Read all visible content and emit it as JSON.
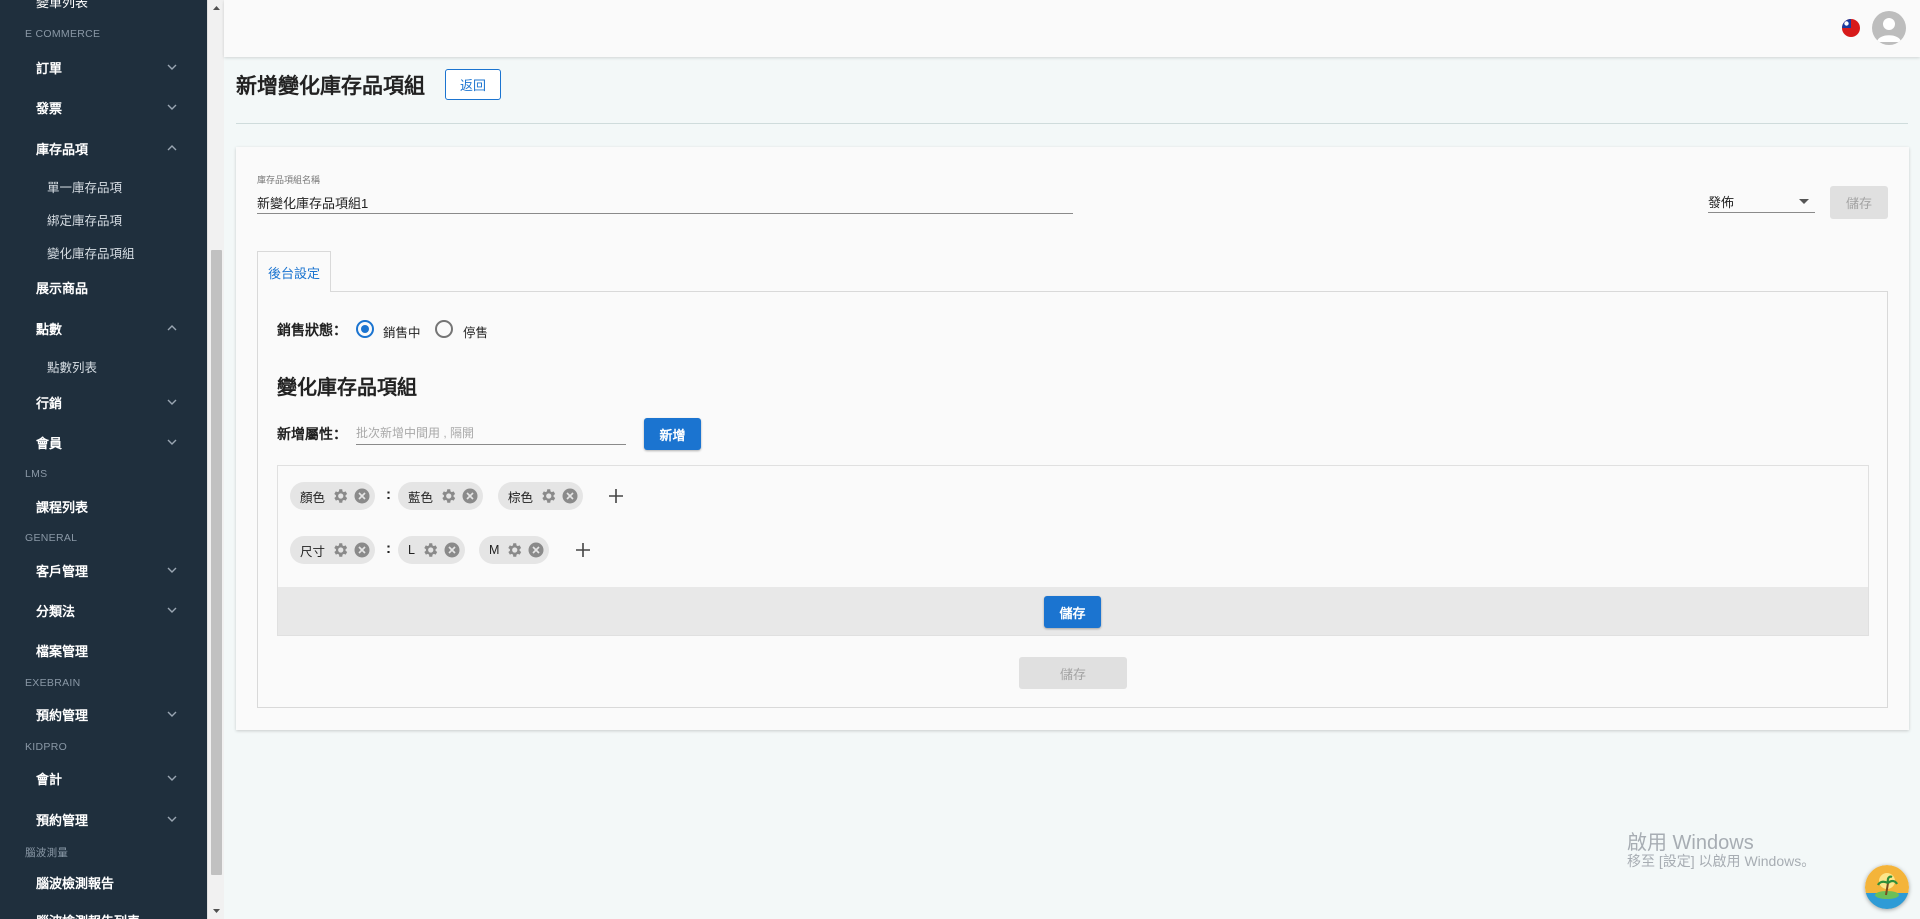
{
  "sidebar": {
    "sections": {
      "ecommerce": "E COMMERCE",
      "lms": "LMS",
      "general": "GENERAL",
      "exebrain": "EXEBRAIN",
      "kidpro": "KIDPRO",
      "eeg": "腦波測量"
    },
    "items": {
      "top_partial": "變單列表",
      "orders": "訂單",
      "invoices": "發票",
      "inventory": "庫存品項",
      "inventory_single": "單一庫存品項",
      "inventory_bundle": "綁定庫存品項",
      "inventory_variant": "變化庫存品項組",
      "showcase": "展示商品",
      "points": "點數",
      "points_list": "點數列表",
      "marketing": "行銷",
      "members": "會員",
      "courses": "課程列表",
      "customers": "客戶管理",
      "taxonomy": "分類法",
      "files": "檔案管理",
      "booking_exebrain": "預約管理",
      "accounting": "會計",
      "booking_kidpro": "預約管理",
      "eeg_report": "腦波檢測報告",
      "bottom_partial": "腦波檢測報告列表"
    }
  },
  "page": {
    "title": "新增變化庫存品項組",
    "back_label": "返回"
  },
  "form": {
    "name_label": "庫存品項組名稱",
    "name_value": "新變化庫存品項組1",
    "publish_value": "發佈",
    "save_top_label": "儲存"
  },
  "tabs": {
    "backend": "後台設定"
  },
  "sale": {
    "label": "銷售狀態：",
    "on_sale": "銷售中",
    "stopped": "停售",
    "selected": "on_sale"
  },
  "variants": {
    "heading": "變化庫存品項組",
    "add_attr_label": "新增屬性：",
    "add_attr_placeholder": "批次新增中間用 , 隔開",
    "add_button": "新增",
    "attr_color": "顏色",
    "color_blue": "藍色",
    "color_brown": "棕色",
    "attr_size": "尺寸",
    "size_l": "L",
    "size_m": "M",
    "colon": ":",
    "save_inner": "儲存",
    "save_bottom": "儲存"
  },
  "watermark": {
    "line1": "啟用 Windows",
    "line2": "移至 [設定] 以啟用 Windows。"
  },
  "colors": {
    "sidebar_bg": "#1f2f3d",
    "primary": "#1b74d0",
    "page_bg": "#f3f8f8",
    "disabled_bg": "#e0e0e0"
  }
}
